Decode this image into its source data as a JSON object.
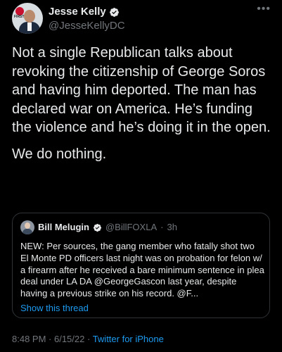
{
  "author": {
    "display_name": "Jesse Kelly",
    "handle": "@JesseKellyDC",
    "avatar_text": "FIRST"
  },
  "icons": {
    "verified": "verified-badge-icon",
    "more": "more-options-icon"
  },
  "tweet": {
    "paragraphs": [
      "Not a single Republican talks about revoking the citizenship of George Soros and having him deported. The man has declared war on America. He’s funding the violence and he’s doing it in the open.",
      "We do nothing."
    ]
  },
  "quoted_tweet": {
    "display_name": "Bill Melugin",
    "handle": "@BillFOXLA",
    "separator": "·",
    "time": "3h",
    "text": "NEW: Per sources, the gang member who fatally shot two El Monte PD officers last night was on probation for felon w/ a firearm after he received a bare minimum sentence in plea deal under LA DA @GeorgeGascon last year, despite having a previous strike on his record. @F...",
    "show_thread": "Show this thread"
  },
  "meta": {
    "time": "8:48 PM",
    "sep1": " · ",
    "date": "6/15/22",
    "sep2": " · ",
    "source": "Twitter for iPhone"
  },
  "colors": {
    "background": "#000000",
    "text": "#e7e9ea",
    "secondary": "#71767b",
    "accent": "#1d9bf0",
    "border": "#2f3336"
  }
}
